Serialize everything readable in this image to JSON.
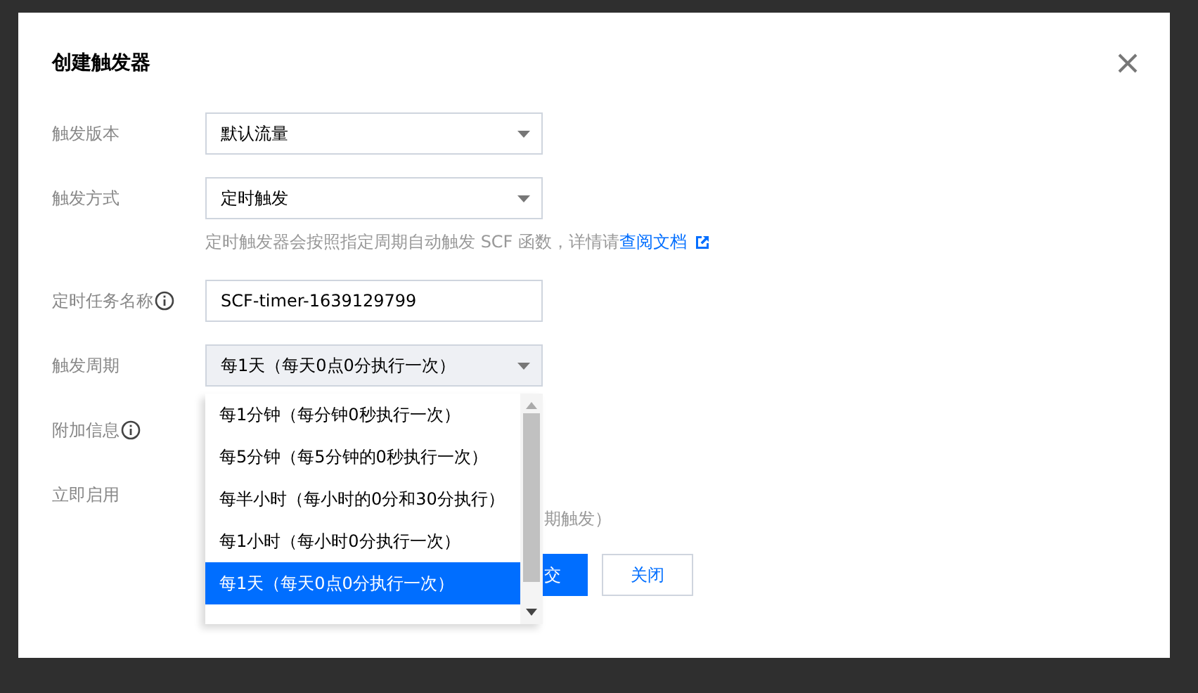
{
  "dialog": {
    "title": "创建触发器"
  },
  "fields": [
    {
      "kind": "select",
      "label": "触发版本",
      "value": "默认流量"
    },
    {
      "kind": "select",
      "label": "触发方式",
      "value": "定时触发",
      "hint": "定时触发器会按照指定周期自动触发 SCF 函数，详情请",
      "hint_link": "查阅文档"
    },
    {
      "kind": "input",
      "label": "定时任务名称",
      "info": true,
      "value": "SCF-timer-1639129799"
    },
    {
      "kind": "select",
      "label": "触发周期",
      "value": "每1天（每天0点0分执行一次）",
      "expanded": true,
      "options": [
        {
          "label": "每1分钟（每分钟0秒执行一次）",
          "selected": false
        },
        {
          "label": "每5分钟（每5分钟的0秒执行一次）",
          "selected": false
        },
        {
          "label": "每半小时（每小时的0分和30分执行）",
          "selected": false
        },
        {
          "label": "每1小时（每小时0分执行一次）",
          "selected": false
        },
        {
          "label": "每1天（每天0点0分执行一次）",
          "selected": true
        }
      ]
    },
    {
      "kind": "covered",
      "label": "附加信息",
      "info": true
    },
    {
      "kind": "covered",
      "label": "立即启用",
      "hint": "期触发）"
    }
  ],
  "buttons": [
    {
      "kind": "primary",
      "label": "交"
    },
    {
      "kind": "default",
      "label": "关闭"
    }
  ]
}
